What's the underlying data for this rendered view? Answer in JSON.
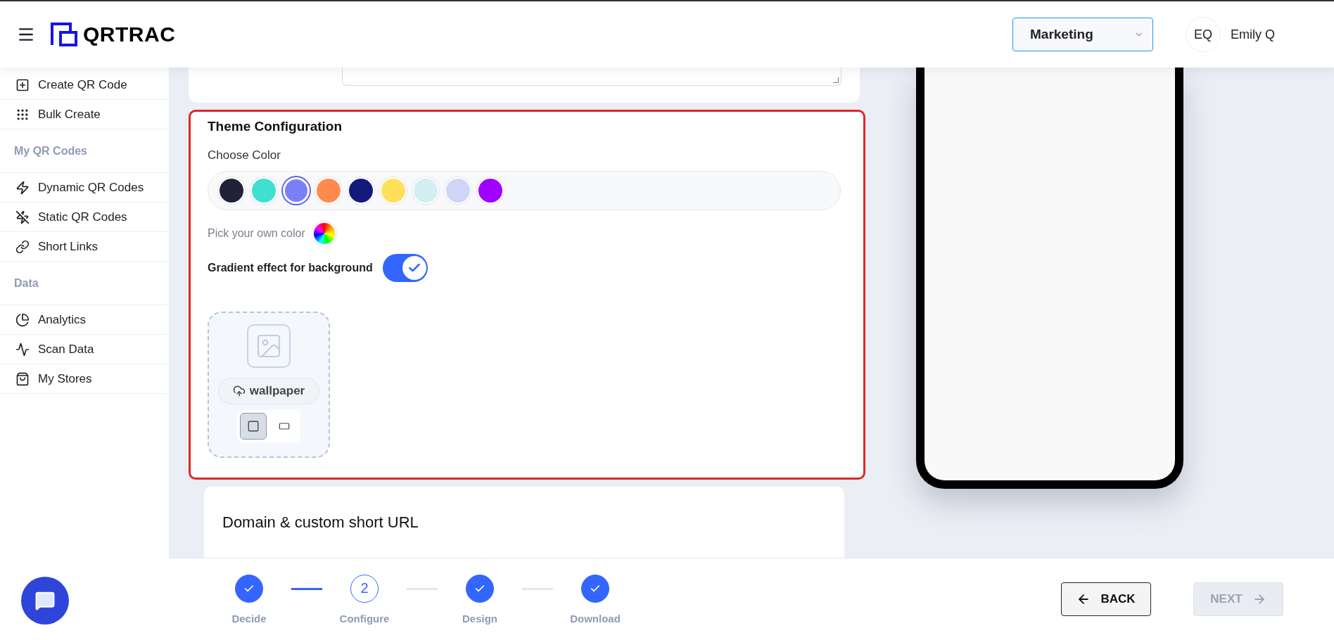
{
  "header": {
    "brand": "QRTRAC",
    "workspace": {
      "value": "Marketing"
    },
    "user": {
      "initials": "EQ",
      "name": "Emily Q"
    }
  },
  "sidebar": [
    {
      "kind": "item",
      "label": "Create QR Code"
    },
    {
      "kind": "item",
      "label": "Bulk Create"
    },
    {
      "kind": "section",
      "label": "My QR Codes"
    },
    {
      "kind": "item",
      "label": "Dynamic QR Codes"
    },
    {
      "kind": "item",
      "label": "Static QR Codes"
    },
    {
      "kind": "item",
      "label": "Short Links"
    },
    {
      "kind": "section",
      "label": "Data"
    },
    {
      "kind": "item",
      "label": "Analytics"
    },
    {
      "kind": "item",
      "label": "Scan Data"
    },
    {
      "kind": "item",
      "label": "My Stores"
    }
  ],
  "theme": {
    "highlighted": true,
    "title": "Theme Configuration",
    "choose_label": "Choose Color",
    "swatches": [
      {
        "color": "#23213a",
        "selected": false
      },
      {
        "color": "#40e0d0",
        "selected": false
      },
      {
        "color": "#7b7ff5",
        "selected": true
      },
      {
        "color": "#ff8a50",
        "selected": false
      },
      {
        "color": "#141a7a",
        "selected": false
      },
      {
        "color": "#ffe05a",
        "selected": false
      },
      {
        "color": "#d4eef2",
        "selected": false
      },
      {
        "color": "#d0d4f5",
        "selected": false
      },
      {
        "color": "#a000ff",
        "selected": false
      }
    ],
    "pick_label": "Pick your own color",
    "gradient": {
      "label": "Gradient effect for background",
      "on": true
    },
    "wallpaper": {
      "button": "wallpaper",
      "shapes": [
        {
          "kind": "square",
          "selected": true
        },
        {
          "kind": "wide",
          "selected": false
        }
      ]
    }
  },
  "domain": {
    "title": "Domain & custom short URL"
  },
  "steps": [
    {
      "label": "Decide",
      "kind": "done"
    },
    {
      "label": "Configure",
      "kind": "current",
      "number": "2"
    },
    {
      "label": "Design",
      "kind": "done"
    },
    {
      "label": "Download",
      "kind": "done"
    }
  ],
  "connectors": [
    {
      "active": true
    },
    {
      "active": false
    },
    {
      "active": false
    }
  ],
  "back": {
    "label": "BACK",
    "disabled": false
  },
  "next": {
    "label": "NEXT",
    "disabled": true
  }
}
